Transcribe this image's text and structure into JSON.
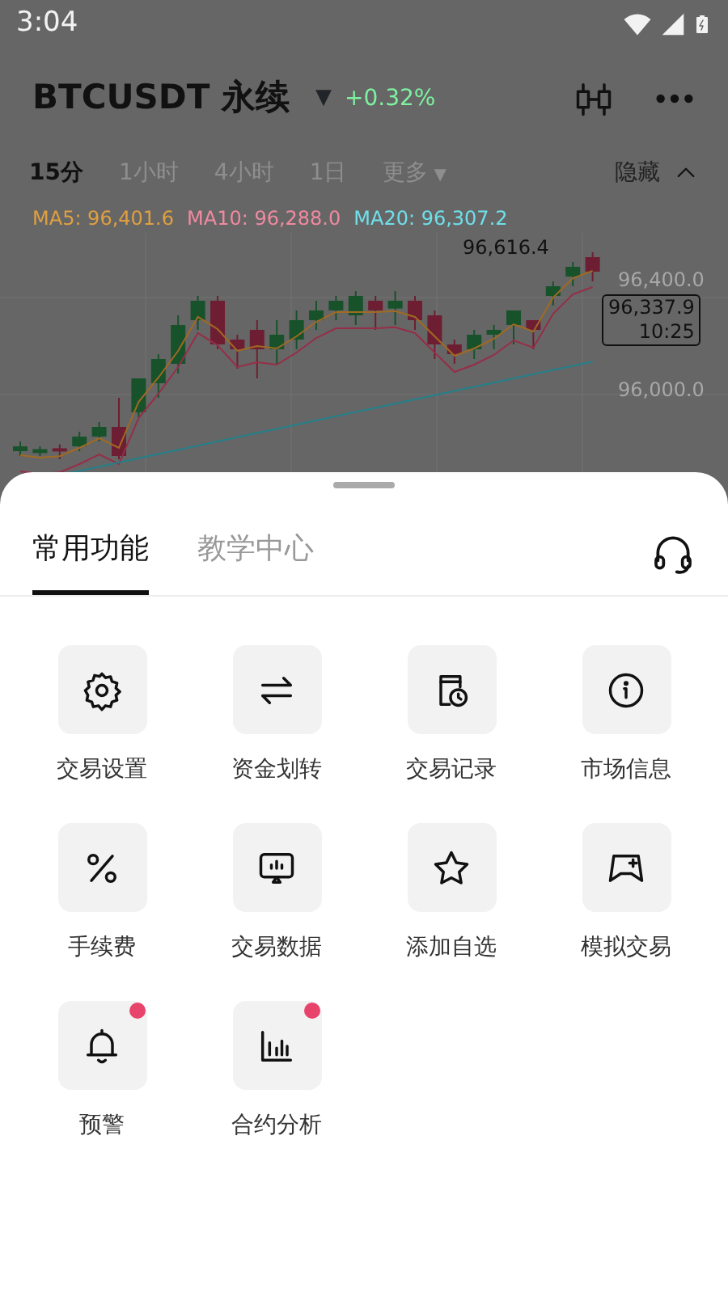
{
  "status_bar": {
    "time": "3:04"
  },
  "header": {
    "symbol": "BTCUSDT 永续",
    "caret": "▼",
    "change": "+0.32%"
  },
  "intervals": [
    {
      "label": "15分",
      "selected": true
    },
    {
      "label": "1小时",
      "selected": false
    },
    {
      "label": "4小时",
      "selected": false
    },
    {
      "label": "1日",
      "selected": false
    },
    {
      "label": "更多",
      "selected": false,
      "caret": "▼"
    }
  ],
  "hide_toggle": {
    "label": "隐藏"
  },
  "moving_averages": [
    {
      "label": "MA5: 96,401.6",
      "color": "#e0a040"
    },
    {
      "label": "MA10: 96,288.0",
      "color": "#f08aa0"
    },
    {
      "label": "MA20: 96,307.2",
      "color": "#6fe0ea"
    }
  ],
  "chart_labels": {
    "high": "96,616.4",
    "price_ticks": [
      "96,400.0",
      "96,000.0"
    ],
    "last_price": "96,337.9",
    "countdown": "10:25"
  },
  "sheet": {
    "tabs": [
      {
        "label": "常用功能",
        "selected": true
      },
      {
        "label": "教学中心",
        "selected": false
      }
    ],
    "items": [
      {
        "label": "交易设置",
        "badge": false
      },
      {
        "label": "资金划转",
        "badge": false
      },
      {
        "label": "交易记录",
        "badge": false
      },
      {
        "label": "市场信息",
        "badge": false
      },
      {
        "label": "手续费",
        "badge": false
      },
      {
        "label": "交易数据",
        "badge": false
      },
      {
        "label": "添加自选",
        "badge": false
      },
      {
        "label": "模拟交易",
        "badge": false
      },
      {
        "label": "预警",
        "badge": true
      },
      {
        "label": "合约分析",
        "badge": true
      }
    ]
  }
}
